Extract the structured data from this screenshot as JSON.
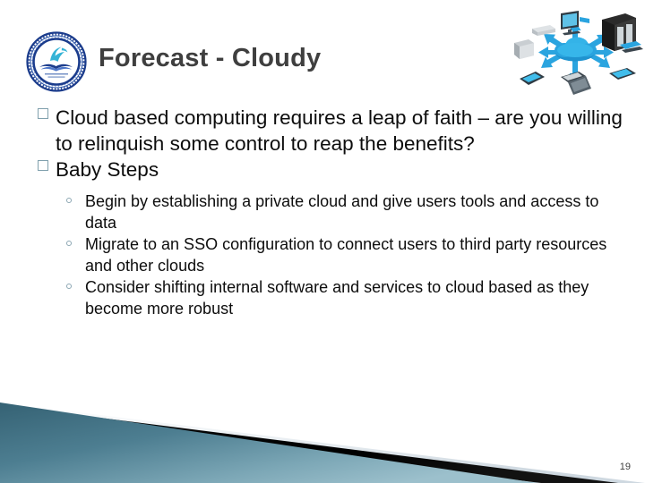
{
  "slide": {
    "title": "Forecast - Cloudy",
    "page_number": "19",
    "logo": {
      "name": "school-seal-logo",
      "arc_text_top": "COMMUNITY SCHOOL",
      "arc_text_bottom": "OF DAVIDSON",
      "center_motto": "Pursue the highest quality in all you do"
    },
    "artwork": {
      "name": "cloud-computing-diagram",
      "description": "Central blue cloud with arrows radiating to servers, laptops, desktops, tablets and smartphones",
      "center_label": "cloud"
    },
    "bullets": [
      {
        "level": 1,
        "marker": "hollow-square",
        "text": "Cloud based computing requires a leap of faith – are you willing to relinquish some control to reap the benefits?"
      },
      {
        "level": 1,
        "marker": "hollow-square",
        "text": "Baby Steps"
      }
    ],
    "sub_bullets": [
      {
        "level": 2,
        "marker": "hollow-circle",
        "text": "Begin by establishing a private cloud and give users tools and access to data"
      },
      {
        "level": 2,
        "marker": "hollow-circle",
        "text": "Migrate to an SSO configuration to connect users to third party resources and other clouds"
      },
      {
        "level": 2,
        "marker": "hollow-circle",
        "text": "Consider shifting internal software and services to cloud based as they become more robust"
      }
    ],
    "colors": {
      "title_text": "#3f3f3f",
      "body_text": "#0d0d0d",
      "bullet_marker": "#80a0ad",
      "banner_teal_dark": "#3c6a7d",
      "banner_teal_light": "#8fb3c0",
      "banner_black": "#000000",
      "banner_gray": "#dde3e8",
      "logo_navy": "#1b3c8c",
      "logo_accent": "#34b3d6",
      "background": "#ffffff"
    }
  }
}
